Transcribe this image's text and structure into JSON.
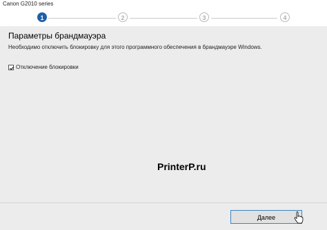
{
  "window": {
    "title": "Canon G2010 series"
  },
  "steps": [
    {
      "label": "1",
      "state": "active"
    },
    {
      "label": "2",
      "state": "inactive"
    },
    {
      "label": "3",
      "state": "inactive"
    },
    {
      "label": "4",
      "state": "inactive"
    }
  ],
  "main": {
    "heading": "Параметры брандмауэра",
    "description": "Необходимо отключить блокировку для этого программного обеспечения в брандмауэре Windows.",
    "checkbox": {
      "label": "Отключение блокировки",
      "checked": true
    }
  },
  "watermark": "PrinterP.ru",
  "footer": {
    "next_label": "Далее"
  },
  "colors": {
    "accent": "#1e5fa8",
    "content_bg": "#ececec"
  }
}
